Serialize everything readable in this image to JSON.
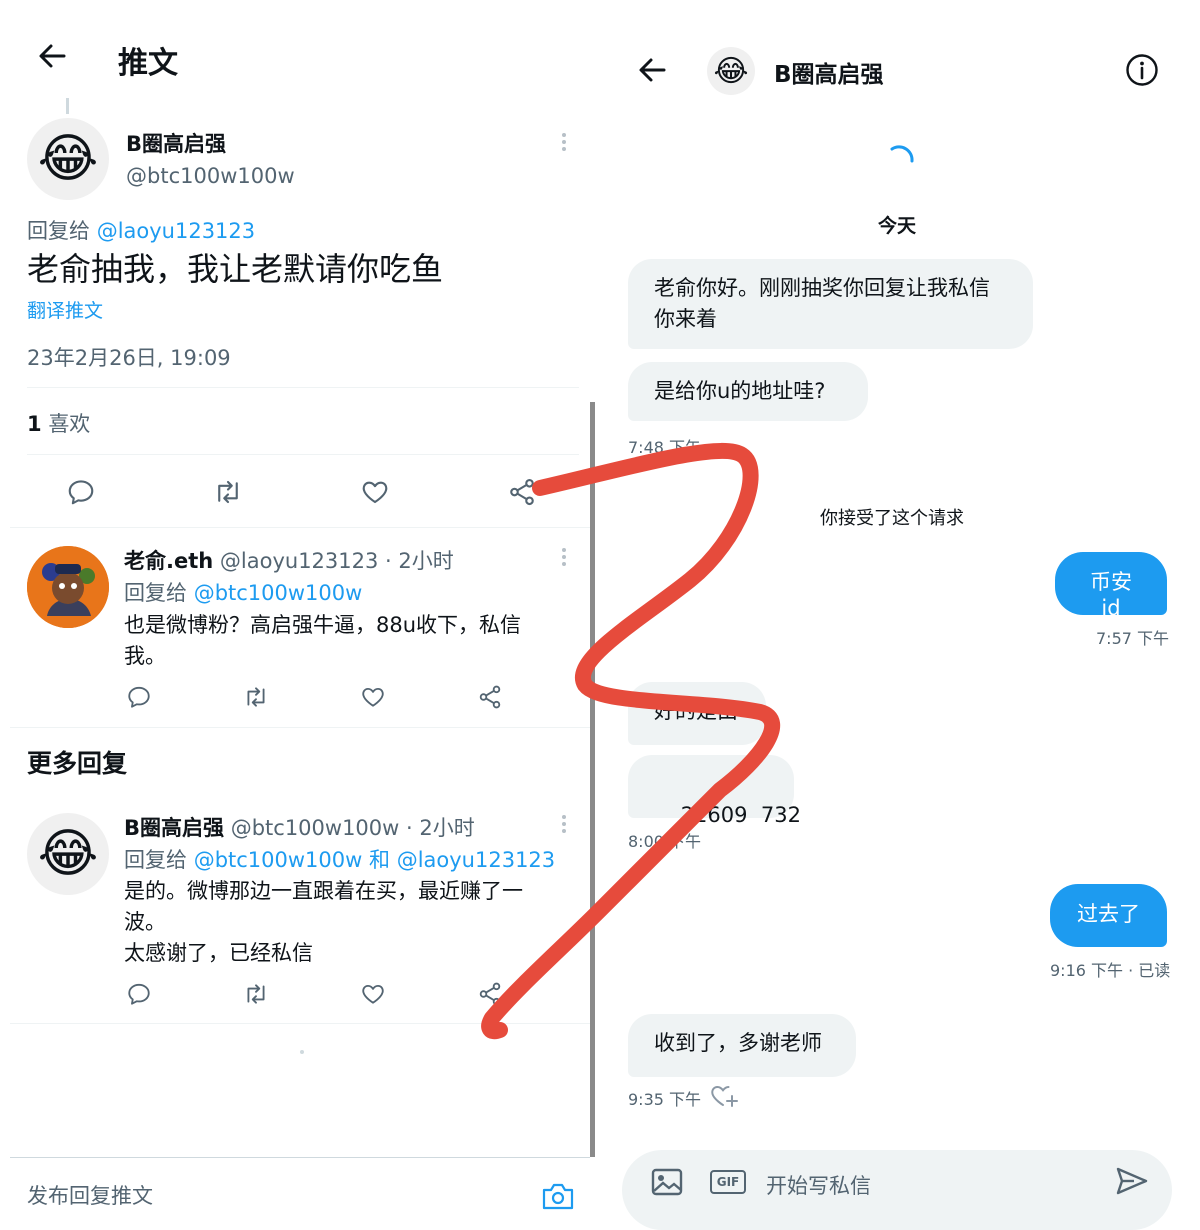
{
  "left": {
    "header_title": "推文",
    "main_tweet": {
      "name": "B圈高启强",
      "handle": "@btc100w100w",
      "reply_to_prefix": "回复给",
      "reply_to_handle": "@laoyu123123",
      "text": "老俞抽我，我让老默请你吃鱼",
      "translate": "翻译推文",
      "timestamp": "23年2月26日, 19:09",
      "likes_count": "1",
      "likes_label": "喜欢"
    },
    "reply1": {
      "name": "老俞.eth",
      "meta": "@laoyu123123 · 2小时",
      "reply_to_prefix": "回复给",
      "reply_to_handle": "@btc100w100w",
      "text_line1": "也是微博粉？高启强牛逼，88u收下，私信",
      "text_line2": "我。"
    },
    "more_replies": "更多回复",
    "reply2": {
      "name": "B圈高启强",
      "meta": "@btc100w100w · 2小时",
      "reply_to_prefix": "回复给",
      "reply_to_handle1": "@btc100w100w",
      "reply_to_and": "和",
      "reply_to_handle2": "@laoyu123123",
      "text_line1": "是的。微博那边一直跟着在买，最近赚了一",
      "text_line2": "波。",
      "text_line3": "太感谢了，已经私信"
    },
    "compose_placeholder": "发布回复推文"
  },
  "right": {
    "header_name": "B圈高启强",
    "date_label": "今天",
    "messages": [
      {
        "text_line1": "老俞你好。刚刚抽奖你回复让我私信",
        "text_line2": "你来着"
      },
      {
        "text": "是给你u的地址哇?"
      }
    ],
    "time1": "7:48 下午",
    "system_note": "你接受了这个请求",
    "out1": "币安id",
    "time2": "7:57 下午",
    "in3_partial": "好的是由",
    "in4": "22609  732",
    "time3": "8:00 下午",
    "out2": "过去了",
    "time4": "9:16 下午 · 已读",
    "in5": "收到了，多谢老师",
    "time5": "9:35 下午",
    "composer_gif": "GIF",
    "composer_placeholder": "开始写私信"
  },
  "colors": {
    "accent": "#1d9bf0",
    "text": "#0f1419",
    "muted": "#536471",
    "bubble_in": "#eff3f4",
    "annotation": "#e64b3c"
  }
}
